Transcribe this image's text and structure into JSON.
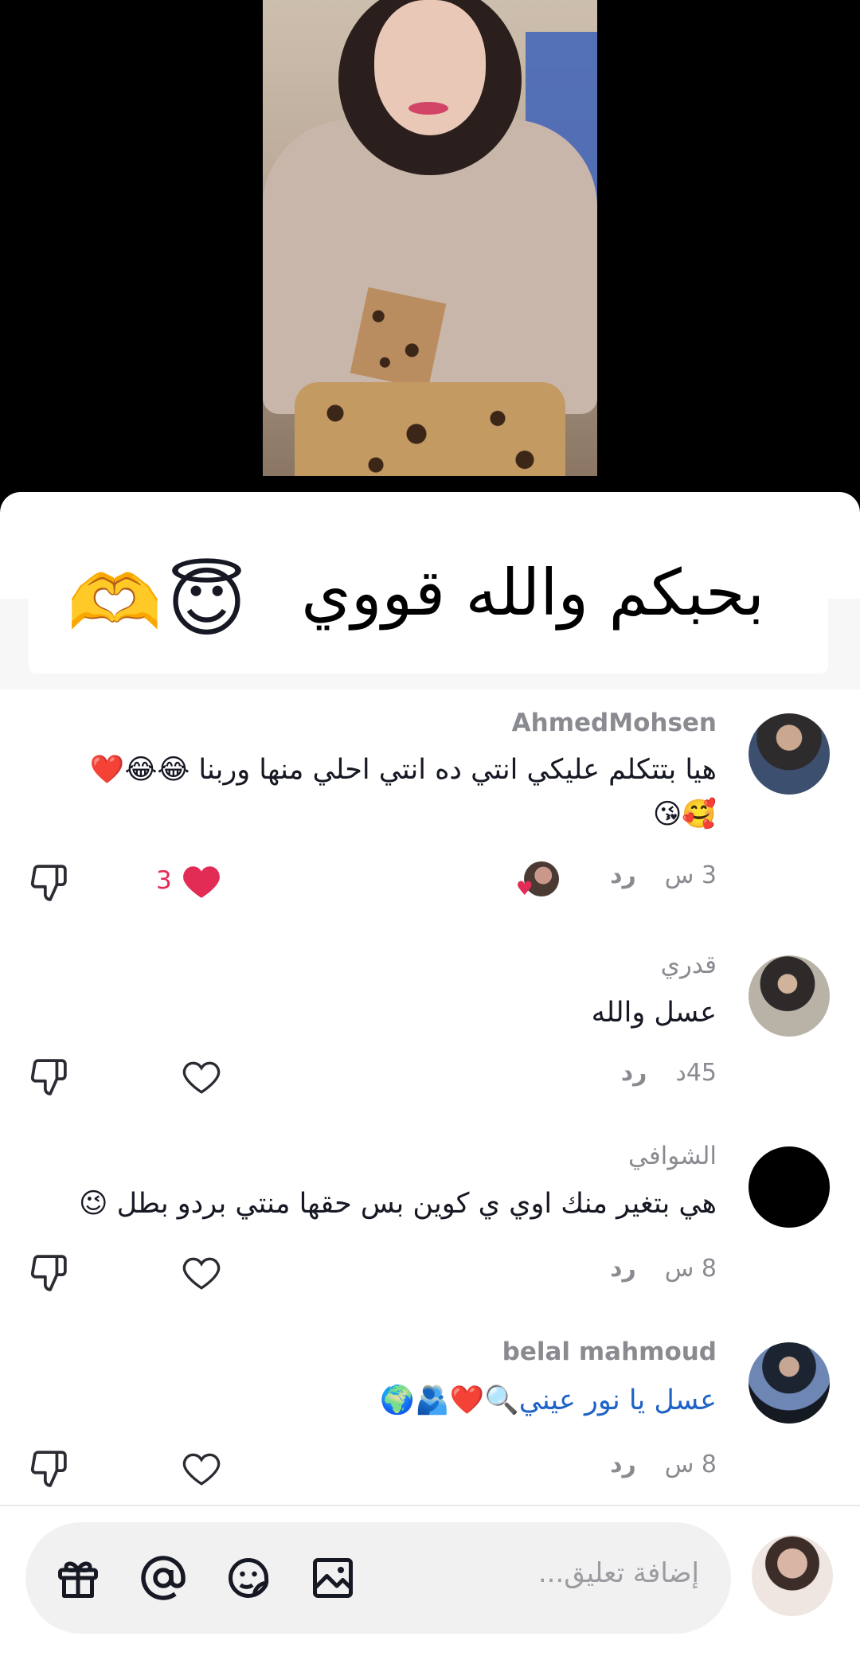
{
  "pinned": {
    "text": "بحبكم والله قووي",
    "emojis": [
      "😇",
      "🫶"
    ]
  },
  "comments": [
    {
      "username": "AhmedMohsen",
      "text_line1": "هيا بتتكلم عليكي انتي ده انتي احلي منها وربنا 😂😂❤️",
      "text_line2": "🥰😘",
      "time": "3 س",
      "reply": "رد",
      "likes": "3",
      "liked": true
    },
    {
      "username": "قدري",
      "text_line1": "عسل والله",
      "time": "45د",
      "reply": "رد",
      "likes": "",
      "liked": false
    },
    {
      "username": "الشوافي",
      "text_line1": "هي بتغير منك اوي ي كوين بس حقها منتي بردو بطل 😉",
      "time": "8 س",
      "reply": "رد",
      "likes": "",
      "liked": false
    },
    {
      "username": "belal mahmoud",
      "text_line1": "عسل يا نور عيني",
      "text_line1_suffix": "🔍❤️🫂🌍",
      "time": "8 س",
      "reply": "رد",
      "likes": "",
      "liked": false
    }
  ],
  "input": {
    "placeholder": "إضافة تعليق..."
  },
  "icons": {
    "bar": [
      "gift-icon",
      "mention-icon",
      "emoji-sticker-icon",
      "image-icon"
    ],
    "actions": [
      "dislike-icon",
      "heart-icon"
    ]
  },
  "colors": {
    "like_red": "#e22b55",
    "link_blue": "#1e63c6",
    "muted": "#8a8b91"
  }
}
